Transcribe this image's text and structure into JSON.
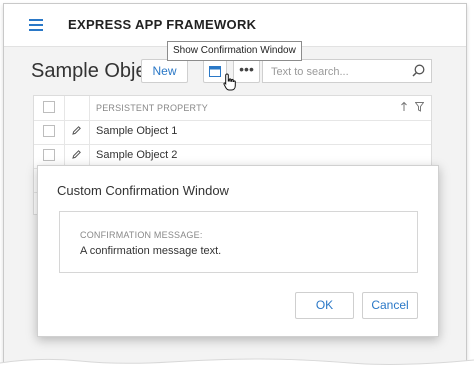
{
  "app": {
    "title": "EXPRESS APP FRAMEWORK"
  },
  "view": {
    "title": "Sample Object"
  },
  "toolbar": {
    "new_label": "New",
    "confirm_icon": "window-icon",
    "more_label": "•••",
    "tooltip": "Show Confirmation Window"
  },
  "search": {
    "placeholder": "Text to search...",
    "value": ""
  },
  "grid": {
    "column_header": "PERSISTENT PROPERTY",
    "rows": [
      {
        "label": "Sample Object 1"
      },
      {
        "label": "Sample Object 2"
      }
    ]
  },
  "dialog": {
    "title": "Custom Confirmation Window",
    "message_label": "CONFIRMATION MESSAGE:",
    "message_text": "A confirmation message text.",
    "ok_label": "OK",
    "cancel_label": "Cancel"
  },
  "colors": {
    "accent": "#2a78c7",
    "background": "#f3f3f3"
  }
}
